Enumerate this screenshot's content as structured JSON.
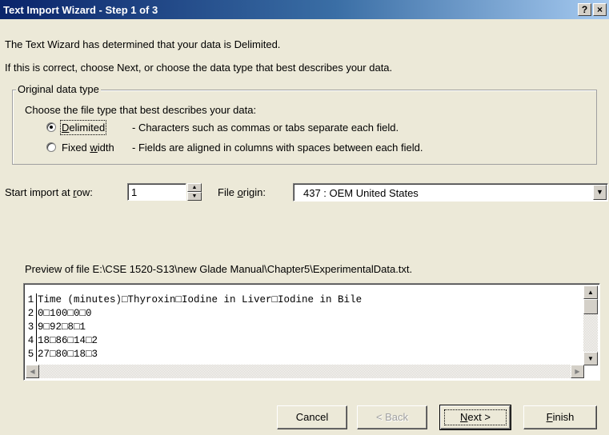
{
  "window": {
    "title": "Text Import Wizard - Step 1 of 3",
    "help_label": "?",
    "close_label": "×"
  },
  "intro": {
    "line1": "The Text Wizard has determined that your data is Delimited.",
    "line2": "If this is correct, choose Next, or choose the data type that best describes your data."
  },
  "original_data_type": {
    "legend": "Original data type",
    "prompt": "Choose the file type that best describes your data:",
    "options": [
      {
        "label_pre": "",
        "label_key": "D",
        "label_post": "elimited",
        "description": "- Characters such as commas or tabs separate each field.",
        "selected": true
      },
      {
        "label_pre": "Fixed ",
        "label_key": "w",
        "label_post": "idth",
        "description": "- Fields are aligned in columns with spaces between each field.",
        "selected": false
      }
    ]
  },
  "start_row": {
    "label_pre": "Start import at ",
    "label_key": "r",
    "label_post": "ow:",
    "value": "1"
  },
  "file_origin": {
    "label_pre": "File ",
    "label_key": "o",
    "label_post": "rigin:",
    "value": "437 : OEM United States"
  },
  "preview": {
    "label": "Preview of file E:\\CSE 1520-S13\\new Glade Manual\\Chapter5\\ExperimentalData.txt.",
    "rows": [
      {
        "num": "1",
        "text": "Time (minutes)□Thyroxin□Iodine in Liver□Iodine in Bile"
      },
      {
        "num": "2",
        "text": "0□100□0□0"
      },
      {
        "num": "3",
        "text": "9□92□8□1"
      },
      {
        "num": "4",
        "text": "18□86□14□2"
      },
      {
        "num": "5",
        "text": "27□80□18□3"
      }
    ]
  },
  "buttons": {
    "cancel": "Cancel",
    "back": "< Back",
    "next_key": "N",
    "next_rest": "ext >",
    "finish_key": "F",
    "finish_rest": "inish"
  }
}
